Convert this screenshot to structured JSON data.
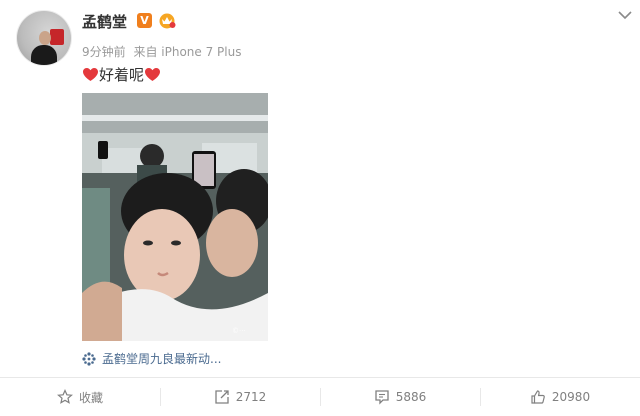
{
  "post": {
    "username": "孟鹤堂",
    "verified_badge": "V",
    "time": "9分钟前",
    "source": "来自 iPhone 7 Plus",
    "text": "好着呢",
    "tag_text": "孟鹤堂周九良最新动..."
  },
  "actions": {
    "favorite": "收藏",
    "repost": "2712",
    "comment": "5886",
    "like": "20980"
  },
  "colors": {
    "accent_orange": "#f07f1d",
    "heart_red": "#e4393c",
    "link_blue": "#4a6a8f",
    "muted_gray": "#9a9a9a"
  },
  "icons": [
    "avatar",
    "verified-v-icon",
    "vip-crown-icon",
    "chevron-down-icon",
    "heart-icon",
    "pinwheel-icon",
    "star-icon",
    "repost-icon",
    "comment-icon",
    "thumbs-up-icon"
  ]
}
